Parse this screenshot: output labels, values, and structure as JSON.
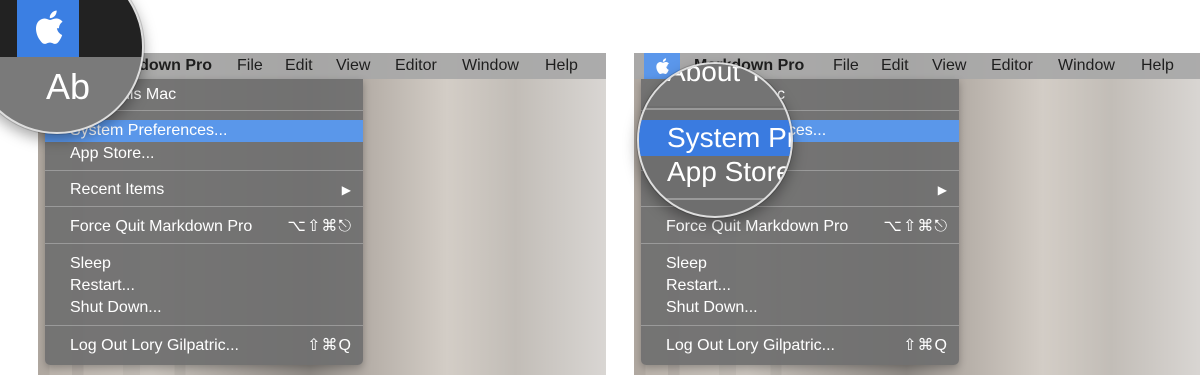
{
  "icons": {
    "apple": "apple-logo-icon",
    "submenu": "triangle-right-icon"
  },
  "colors": {
    "highlight": "#5a97ea",
    "menu_bg": "#707070",
    "menubar_bg": "#a8a8a8"
  },
  "menubar": {
    "app": "Markdown Pro",
    "items": [
      "File",
      "Edit",
      "View",
      "Editor",
      "Window",
      "Help"
    ]
  },
  "apple_menu": {
    "about": "About This Mac",
    "about_visible": "nis Mac",
    "system_prefs": "System Preferences...",
    "system_prefs_visible_right": "nces...",
    "app_store": "App Store...",
    "recent": "Recent Items",
    "recent_arrow": "▶",
    "force_quit": "Force Quit Markdown Pro",
    "force_quit_shortcut": "⌥⇧⌘⎋",
    "sleep": "Sleep",
    "restart": "Restart...",
    "shutdown": "Shut Down...",
    "logout": "Log Out Lory  Gilpatric...",
    "logout_shortcut": "⇧⌘Q"
  },
  "left_partial": {
    "app_name": "rkdown Pro"
  },
  "right_partial": {
    "about": "c"
  },
  "magnifier_left": {
    "text": "Ab"
  },
  "magnifier_right": {
    "line1": "About Th",
    "line2": "System Pr",
    "line3": "App Store"
  }
}
